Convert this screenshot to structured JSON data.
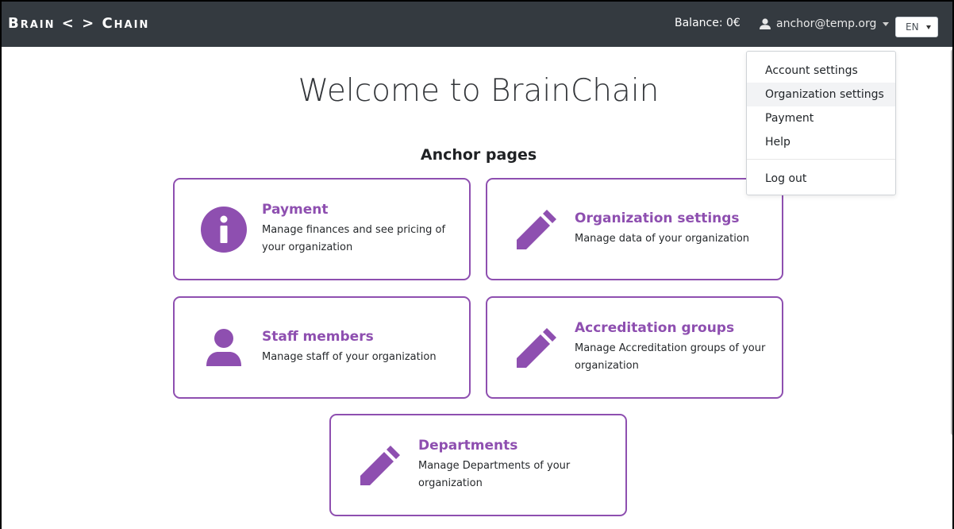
{
  "navbar": {
    "brand": "Brain < > Chain",
    "balance": "Balance: 0€",
    "user_email": "anchor@temp.org",
    "language": "EN"
  },
  "dropdown": {
    "items": [
      {
        "label": "Account settings",
        "active": false
      },
      {
        "label": "Organization settings",
        "active": true
      },
      {
        "label": "Payment",
        "active": false
      },
      {
        "label": "Help",
        "active": false
      }
    ],
    "logout_label": "Log out"
  },
  "main": {
    "title": "Welcome to BrainChain",
    "section_title": "Anchor pages",
    "cards": [
      {
        "icon": "info-circle-icon",
        "title": "Payment",
        "description": "Manage finances and see pricing of your organization"
      },
      {
        "icon": "pencil-icon",
        "title": "Organization settings",
        "description": "Manage data of your organization"
      },
      {
        "icon": "user-icon",
        "title": "Staff members",
        "description": "Manage staff of your organization"
      },
      {
        "icon": "pencil-icon",
        "title": "Accreditation groups",
        "description": "Manage Accreditation groups of your organization"
      },
      {
        "icon": "pencil-icon",
        "title": "Departments",
        "description": "Manage Departments of your organization"
      }
    ]
  },
  "colors": {
    "navbar_bg": "#343a40",
    "accent": "#8e4fb0",
    "text": "#212529"
  }
}
